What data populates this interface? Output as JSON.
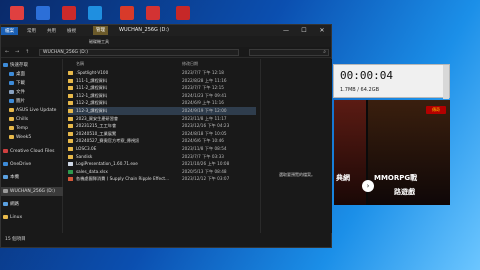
{
  "desktop_icons": [
    {
      "label": "",
      "color": "#e04040"
    },
    {
      "label": "",
      "color": "#2c6fd8"
    },
    {
      "label": "",
      "color": "#cc2a2a"
    },
    {
      "label": "",
      "color": "#1f8fe0"
    },
    {
      "label": "",
      "color": "#d83a2a"
    },
    {
      "label": "",
      "color": "#d33333"
    },
    {
      "label": "",
      "color": "#c62828"
    }
  ],
  "explorer": {
    "tabs": [
      "檔案",
      "常用",
      "共用",
      "檢視",
      "磁碟機工具"
    ],
    "context_tab": "管理",
    "title": "WUCHAN_256G (D:)",
    "window_buttons": [
      "—",
      "☐",
      "✕"
    ],
    "address": "WUCHAN_256G (D:)",
    "nav": [
      "←",
      "→",
      "↑"
    ],
    "search_icon": "search-icon",
    "sidebar": [
      {
        "label": "快速存取",
        "color": "#3d8bd8"
      },
      {
        "label": "桌面",
        "color": "#3d8bd8"
      },
      {
        "label": "下載",
        "color": "#3d8bd8"
      },
      {
        "label": "文件",
        "color": "#8aa3c2"
      },
      {
        "label": "圖片",
        "color": "#3d8bd8"
      },
      {
        "label": "ASUS Live Update",
        "color": "#e8b94a"
      },
      {
        "label": "Chills",
        "color": "#e8b94a"
      },
      {
        "label": "Temp",
        "color": "#e8b94a"
      },
      {
        "label": "Week5",
        "color": "#e8b94a"
      },
      {
        "label": "Creative Cloud Files",
        "color": "#d04040"
      },
      {
        "label": "OneDrive",
        "color": "#3d8bd8"
      },
      {
        "label": "本機",
        "color": "#5aa0e0"
      },
      {
        "label": "WUCHAN_256G (D:)",
        "color": "#9a9a9a"
      },
      {
        "label": "網路",
        "color": "#5aa0e0"
      },
      {
        "label": "Linux",
        "color": "#e8b94a"
      }
    ],
    "columns": {
      "name": "名稱",
      "date": "修改日期"
    },
    "files": [
      {
        "name": ".Spotlight-V100",
        "date": "2023/7/7 下午 12:18",
        "type": "folder"
      },
      {
        "name": "111-1_課程資料",
        "date": "2022/8/28 上午 11:16",
        "type": "folder"
      },
      {
        "name": "111-2_課程資料",
        "date": "2023/7/7 下午 12:15",
        "type": "folder"
      },
      {
        "name": "112-1_課程資料",
        "date": "2024/1/23 下午 09:41",
        "type": "folder"
      },
      {
        "name": "112-2_課程資料",
        "date": "2024/6/9 上午 11:16",
        "type": "folder"
      },
      {
        "name": "112-3_課程資料",
        "date": "2024/9/19 下午 12:00",
        "type": "folder",
        "selected": true
      },
      {
        "name": "2023_資安生產研習會",
        "date": "2023/11/8 上午 11:17",
        "type": "folder"
      },
      {
        "name": "20231215_工工年會",
        "date": "2023/12/16 下午 04:23",
        "type": "folder"
      },
      {
        "name": "20240510_工業展覽",
        "date": "2024/8/18 下午 10:05",
        "type": "folder"
      },
      {
        "name": "20240527_賽奧官方考察_傳視訊",
        "date": "2024/6/6 下午 10:46",
        "type": "folder"
      },
      {
        "name": "LOSC3.0E",
        "date": "2023/11/8 下午 08:54",
        "type": "folder"
      },
      {
        "name": "Sandisk",
        "date": "2023/7/7 下午 03:33",
        "type": "folder"
      },
      {
        "name": "LogiPresentation_1.60.71.exe",
        "date": "2021/10/26 上午 10:08",
        "type": "file"
      },
      {
        "name": "sales_data.xlsx",
        "date": "2020/5/13 下午 08:48",
        "type": "file"
      },
      {
        "name": "各機處團隊消費 ( Supply Chain Ripple Effect...",
        "date": "2023/12/12 下午 03:07",
        "type": "file"
      }
    ],
    "preview_message": "選取要預覽的檔案。",
    "status": "15 個項目"
  },
  "recorder": {
    "time": "00:00:04",
    "size": "1.7MB / 64.2GB"
  },
  "ad": {
    "left_text": "典網",
    "right_title": "MMORPG戰",
    "right_sub": "路遊戲",
    "arrow": "›",
    "badge": "傳奇"
  },
  "colors": {
    "folder": "#e8b94a",
    "selection": "#2f3d4d",
    "explorer_bg": "#191919"
  }
}
